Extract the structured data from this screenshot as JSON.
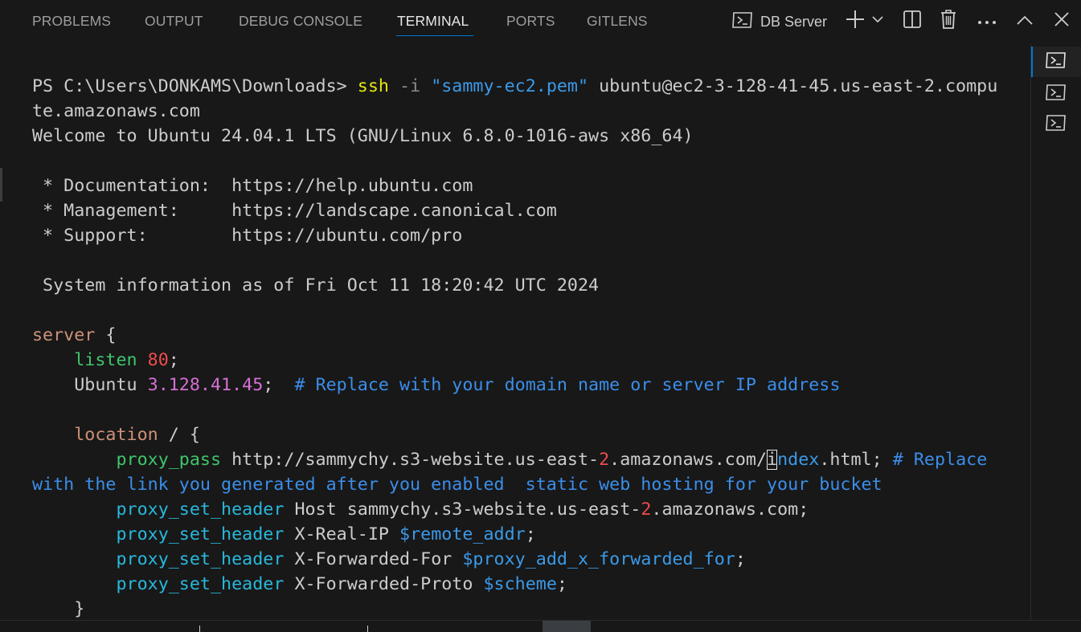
{
  "panel": {
    "tabs": [
      {
        "label": "PROBLEMS",
        "active": false
      },
      {
        "label": "OUTPUT",
        "active": false
      },
      {
        "label": "DEBUG CONSOLE",
        "active": false
      },
      {
        "label": "TERMINAL",
        "active": true
      },
      {
        "label": "PORTS",
        "active": false
      },
      {
        "label": "GITLENS",
        "active": false
      }
    ],
    "terminal_profile": "DB Server",
    "actions": [
      "new-terminal",
      "launch-profile-dropdown",
      "split-terminal",
      "kill-terminal",
      "more-actions",
      "maximize-panel",
      "close-panel"
    ]
  },
  "terminal": {
    "prompt": "PS C:\\Users\\DONKAMS\\Downloads> ",
    "command": "ssh",
    "flag": " -i ",
    "key_file": "\"sammy-ec2.pem\"",
    "host_part1": " ubuntu@ec2-3-128-41-45.us-east-2.compu",
    "host_part2": "te.amazonaws.com",
    "welcome": "Welcome to Ubuntu 24.04.1 LTS (GNU/Linux 6.8.0-1016-aws x86_64)",
    "doc_line": " * Documentation:  https://help.ubuntu.com",
    "mgmt_line": " * Management:     https://landscape.canonical.com",
    "support_line": " * Support:        https://ubuntu.com/pro",
    "sysinfo": " System information as of Fri Oct 11 18:20:42 UTC 2024",
    "server_kw": "server",
    "open_brace": " {",
    "indent1": "    ",
    "indent2": "        ",
    "listen_kw": "listen",
    "listen_port": "80",
    "semicolon": ";",
    "ubuntu_label": "Ubuntu ",
    "ubuntu_ip": "3.128.41.45",
    "ubuntu_semi": ";  ",
    "ubuntu_comment": "# Replace with your domain name or server IP address",
    "location_kw": "location",
    "location_rest": " / {",
    "proxy_pass_kw": "proxy_pass",
    "proxy_pass_url1": " http://sammychy.s3-website.us-east-",
    "proxy_pass_num": "2",
    "proxy_pass_url2": ".amazonaws.com/",
    "proxy_pass_cursor": "i",
    "proxy_pass_url3": "ndex",
    "proxy_pass_url4": ".html; ",
    "proxy_pass_comment1": "# Replace",
    "proxy_pass_comment2": "with the link you generated after you enabled  static web hosting for your bucket",
    "psh_kw": "proxy_set_header",
    "psh_host_label": " Host sammychy.s3-website.us-east-",
    "psh_host_num": "2",
    "psh_host_rest": ".amazonaws.com;",
    "psh_realip_label": " X-Real-IP ",
    "psh_realip_var": "$remote_addr",
    "psh_fwdfor_label": " X-Forwarded-For ",
    "psh_fwdfor_var": "$proxy_add_x_forwarded_for",
    "psh_proto_label": " X-Forwarded-Proto ",
    "psh_proto_var": "$scheme",
    "close_brace": "}"
  },
  "terminal_tabs": [
    {
      "icon": "terminal-icon",
      "active": true
    },
    {
      "icon": "terminal-icon",
      "active": false
    },
    {
      "icon": "terminal-icon",
      "active": false
    }
  ],
  "colors": {
    "background": "#181818",
    "accent": "#0078d4",
    "command_yellow": "#e5e510",
    "string_blue": "#3b9ae8",
    "keyword_orange": "#ce9178",
    "directive_green": "#3fc56b",
    "number_red": "#f14c4c",
    "ip_magenta": "#d670d6",
    "comment_blue": "#3b8eea",
    "proxy_cyan": "#29b8db"
  }
}
